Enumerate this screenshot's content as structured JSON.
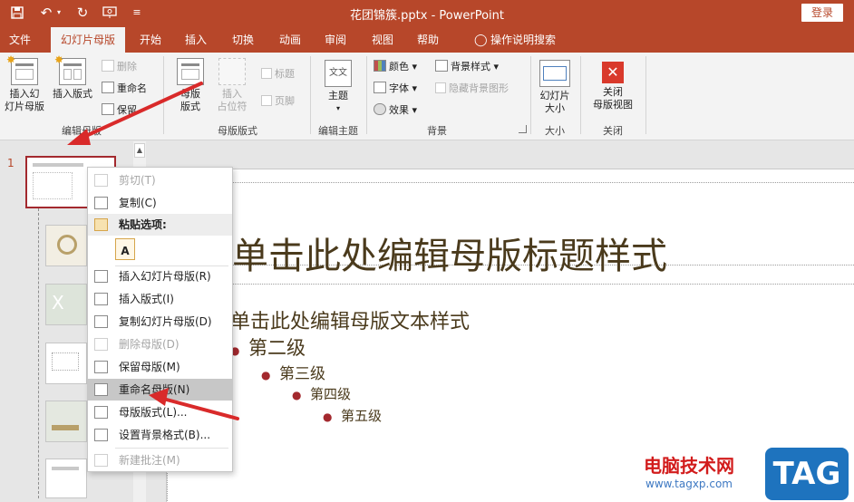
{
  "window": {
    "title": "花团锦簇.pptx  -  PowerPoint",
    "login_label": "登录",
    "quick_access": [
      "save-icon",
      "undo-icon",
      "redo-icon",
      "present-icon",
      "more-icon"
    ]
  },
  "tabs": [
    {
      "label": "文件"
    },
    {
      "label": "幻灯片母版"
    },
    {
      "label": "开始"
    },
    {
      "label": "插入"
    },
    {
      "label": "切换"
    },
    {
      "label": "动画"
    },
    {
      "label": "审阅"
    },
    {
      "label": "视图"
    },
    {
      "label": "帮助"
    },
    {
      "label": "操作说明搜索"
    }
  ],
  "ribbon": {
    "edit_master": {
      "label": "编辑母版",
      "insert_slide_master": "插入幻\n灯片母版",
      "insert_layout": "插入版式",
      "delete": "删除",
      "rename": "重命名",
      "preserve": "保留"
    },
    "master_layout": {
      "label": "母版版式",
      "master_layout_btn": "母版\n版式",
      "insert_placeholder": "插入\n占位符",
      "title_check": "标题",
      "footer_check": "页脚"
    },
    "edit_theme": {
      "label": "编辑主题",
      "themes": "主题",
      "theme_icon_text": "文文"
    },
    "background": {
      "label": "背景",
      "colors": "颜色",
      "fonts": "字体",
      "effects": "效果",
      "bg_styles": "背景样式",
      "hide_bg": "隐藏背景图形"
    },
    "size": {
      "label": "大小",
      "slide_size": "幻灯片\n大小"
    },
    "close": {
      "label": "关闭",
      "close_master": "关闭\n母版视图"
    }
  },
  "thumbnails": {
    "slide_number": "1"
  },
  "slide": {
    "title": "单击此处编辑母版标题样式",
    "body_level1": "单击此处编辑母版文本样式",
    "level2": "第二级",
    "level3": "第三级",
    "level4": "第四级",
    "level5": "第五级"
  },
  "context_menu": {
    "cut": "剪切(T)",
    "copy": "复制(C)",
    "paste_options": "粘贴选项:",
    "paste_glyph": "A",
    "insert_slide_master": "插入幻灯片母版(R)",
    "insert_layout": "插入版式(I)",
    "duplicate_master": "复制幻灯片母版(D)",
    "delete_master": "删除母版(D)",
    "preserve_master": "保留母版(M)",
    "rename_master": "重命名母版(N)",
    "master_layout": "母版版式(L)...",
    "format_background": "设置背景格式(B)...",
    "new_comment": "新建批注(M)"
  },
  "watermark": {
    "site_name": "电脑技术网",
    "url": "www.tagxp.com",
    "tag": "TAG"
  },
  "colors": {
    "accent": "#b7472a",
    "highlight": "#c7c7c7",
    "arrow": "#d92a2a"
  }
}
